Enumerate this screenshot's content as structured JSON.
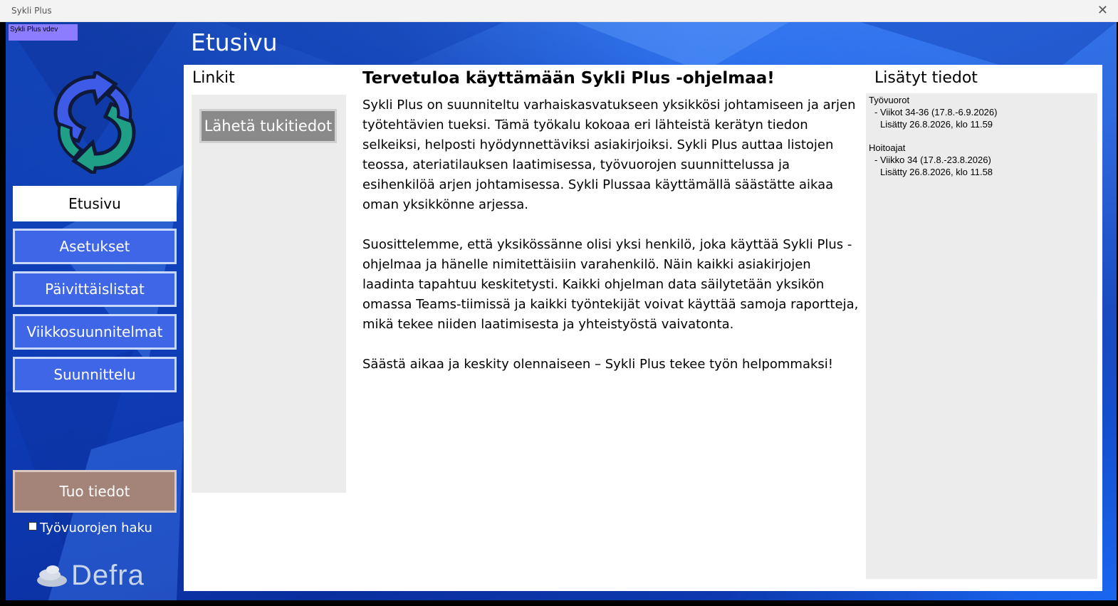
{
  "window": {
    "title": "Sykli Plus",
    "close_glyph": "✕"
  },
  "version_badge": "Sykli Plus vdev",
  "page_title": "Etusivu",
  "nav": [
    {
      "label": "Etusivu",
      "active": true
    },
    {
      "label": "Asetukset",
      "active": false
    },
    {
      "label": "Päivittäislistat",
      "active": false
    },
    {
      "label": "Viikkosuunnitelmat",
      "active": false
    },
    {
      "label": "Suunnittelu",
      "active": false
    }
  ],
  "import_button": "Tuo tiedot",
  "shift_fetch": {
    "label": "Työvuorojen haku",
    "checked": false
  },
  "brand": "Defra",
  "links": {
    "heading": "Linkit",
    "support_button": "Lähetä tukitiedot"
  },
  "welcome": {
    "heading": "Tervetuloa käyttämään Sykli Plus -ohjelmaa!",
    "paragraphs": [
      "Sykli Plus on suunniteltu varhaiskasvatukseen yksikkösi johtamiseen ja arjen työtehtävien tueksi. Tämä työkalu kokoaa eri lähteistä kerätyn tiedon selkeiksi, helposti hyödynnettäviksi asiakirjoiksi. Sykli Plus auttaa listojen teossa, ateriatilauksen laatimisessa, työvuorojen suunnittelussa ja esihenkilöä arjen johtamisessa. Sykli Plussaa käyttämällä säästätte aikaa oman yksikkönne arjessa.",
      "Suosittelemme, että yksikössänne olisi yksi henkilö, joka käyttää Sykli Plus -ohjelmaa ja hänelle nimitettäisiin varahenkilö. Näin kaikki asiakirjojen laadinta tapahtuu keskitetysti. Kaikki ohjelman data säilytetään yksikön omassa Teams-tiimissä ja kaikki työntekijät voivat käyttää samoja raportteja, mikä tekee niiden laatimisesta ja yhteistyöstä vaivatonta.",
      "Säästä aikaa ja keskity olennaiseen – Sykli Plus tekee työn helpommaksi!"
    ]
  },
  "added": {
    "heading": "Lisätyt tiedot",
    "groups": [
      {
        "name": "Työvuorot",
        "line1": "- Viikot 34-36 (17.8.-6.9.2026)",
        "line2": "Lisätty 26.8.2026, klo 11.59"
      },
      {
        "name": "Hoitoajat",
        "line1": "- Viikko 34 (17.8.-23.8.2026)",
        "line2": "Lisätty 26.8.2026, klo 11.58"
      }
    ]
  },
  "colors": {
    "nav_button": "#3f66e6",
    "nav_active": "#ffffff",
    "import_button": "#a48378",
    "support_button": "#8a8a8a",
    "version_badge": "#8c7cff"
  }
}
